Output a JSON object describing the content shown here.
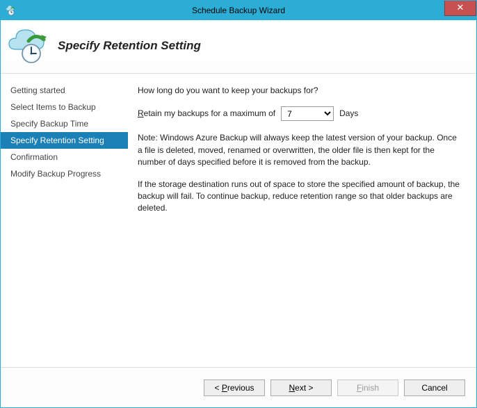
{
  "window": {
    "title": "Schedule Backup Wizard",
    "close_label": "✕"
  },
  "header": {
    "heading": "Specify Retention Setting"
  },
  "sidebar": {
    "items": [
      {
        "label": "Getting started",
        "active": false
      },
      {
        "label": "Select Items to Backup",
        "active": false
      },
      {
        "label": "Specify Backup Time",
        "active": false
      },
      {
        "label": "Specify Retention Setting",
        "active": true
      },
      {
        "label": "Confirmation",
        "active": false
      },
      {
        "label": "Modify Backup Progress",
        "active": false
      }
    ]
  },
  "content": {
    "question": "How long do you want to keep your backups for?",
    "retain_prefix": "R",
    "retain_rest": "etain my backups for a maximum of",
    "retain_value": "7",
    "retain_unit": "Days",
    "note": "Note: Windows Azure Backup will always keep the latest version of your backup. Once a file is deleted, moved, renamed or overwritten, the older file is then kept for the number of days specified before it is removed from the backup.",
    "warn": "If the storage destination runs out of space to store the specified amount of backup, the backup will fail. To continue backup, reduce retention range so that older backups are deleted."
  },
  "footer": {
    "previous_sym": "< ",
    "previous_u": "P",
    "previous_rest": "revious",
    "next_u": "N",
    "next_rest": "ext >",
    "finish_u": "F",
    "finish_rest": "inish",
    "cancel": "Cancel"
  }
}
